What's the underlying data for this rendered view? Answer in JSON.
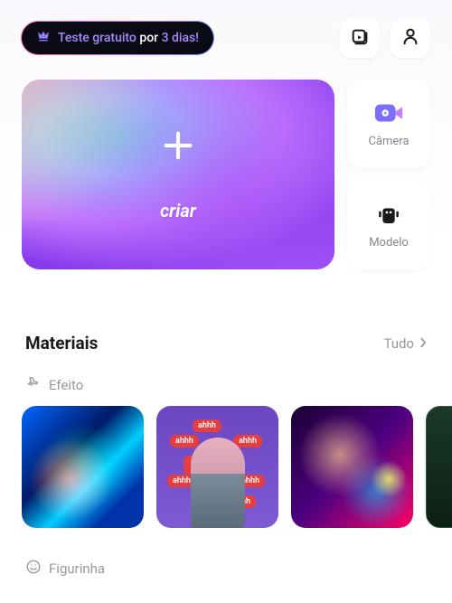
{
  "header": {
    "trial": {
      "part1": "Teste gratuito",
      "part2": " por ",
      "part3": "3 dias!"
    }
  },
  "create": {
    "label": "criar"
  },
  "side": {
    "camera": {
      "label": "Câmera"
    },
    "model": {
      "label": "Modelo"
    }
  },
  "materials": {
    "title": "Materiais",
    "all": "Tudo",
    "effect": "Efeito",
    "sticker": "Figurinha"
  },
  "bubbles": {
    "main": "ahhhh",
    "small": "ahhh"
  }
}
